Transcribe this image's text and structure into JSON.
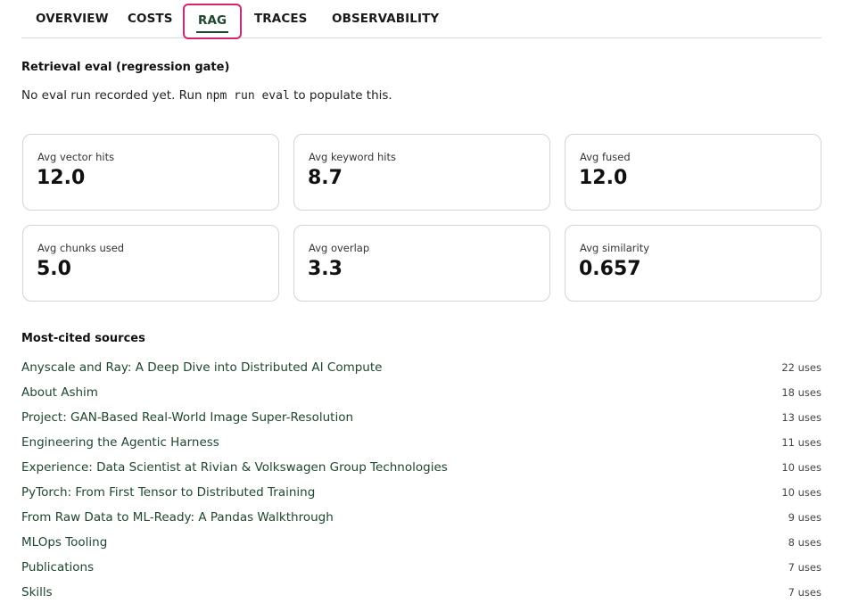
{
  "tabs": [
    {
      "label": "OVERVIEW",
      "active": false
    },
    {
      "label": "COSTS",
      "active": false
    },
    {
      "label": "RAG",
      "active": true
    },
    {
      "label": "TRACES",
      "active": false
    },
    {
      "label": "OBSERVABILITY",
      "active": false
    }
  ],
  "eval": {
    "title": "Retrieval eval (regression gate)",
    "text_before": "No eval run recorded yet. Run ",
    "command": "npm run eval",
    "text_after": " to populate this."
  },
  "metrics": [
    {
      "label": "Avg vector hits",
      "value": "12.0"
    },
    {
      "label": "Avg keyword hits",
      "value": "8.7"
    },
    {
      "label": "Avg fused",
      "value": "12.0"
    },
    {
      "label": "Avg chunks used",
      "value": "5.0"
    },
    {
      "label": "Avg overlap",
      "value": "3.3"
    },
    {
      "label": "Avg similarity",
      "value": "0.657"
    }
  ],
  "sources": {
    "title": "Most-cited sources",
    "items": [
      {
        "name": "Anyscale and Ray: A Deep Dive into Distributed AI Compute",
        "uses": "22 uses"
      },
      {
        "name": "About Ashim",
        "uses": "18 uses"
      },
      {
        "name": "Project: GAN-Based Real-World Image Super-Resolution",
        "uses": "13 uses"
      },
      {
        "name": "Engineering the Agentic Harness",
        "uses": "11 uses"
      },
      {
        "name": "Experience: Data Scientist at Rivian & Volkswagen Group Technologies",
        "uses": "10 uses"
      },
      {
        "name": "PyTorch: From First Tensor to Distributed Training",
        "uses": "10 uses"
      },
      {
        "name": "From Raw Data to ML-Ready: A Pandas Walkthrough",
        "uses": "9 uses"
      },
      {
        "name": "MLOps Tooling",
        "uses": "8 uses"
      },
      {
        "name": "Publications",
        "uses": "7 uses"
      },
      {
        "name": "Skills",
        "uses": "7 uses"
      }
    ]
  },
  "colors": {
    "accent_green": "#1f4630",
    "focus_ring": "#d6246e"
  }
}
